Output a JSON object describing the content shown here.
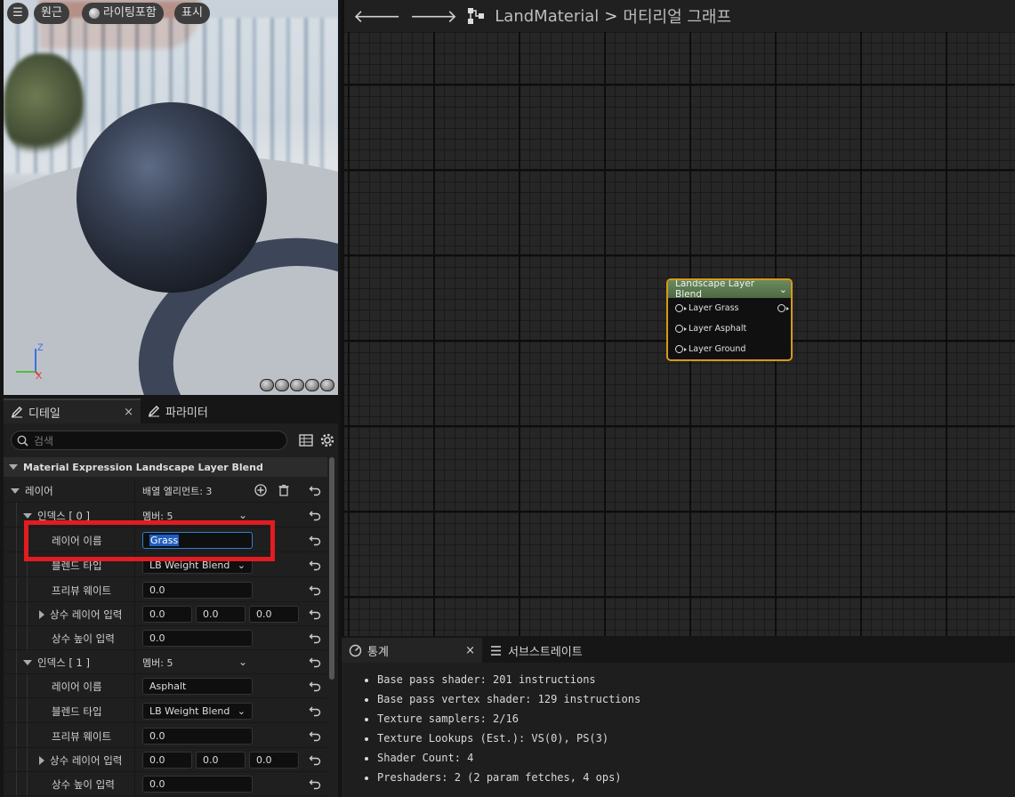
{
  "viewport": {
    "buttons": {
      "menu": "☰",
      "perspective": "원근",
      "lighting": "라이팅포함",
      "show": "표시"
    },
    "gizmo": {
      "z": "Z",
      "x": "X"
    }
  },
  "details": {
    "tabs": [
      {
        "label": "디테일"
      },
      {
        "label": "파라미터"
      }
    ],
    "search_placeholder": "검색",
    "category": "Material Expression Landscape Layer Blend",
    "layers_label": "레이어",
    "layers_value": "배열 엘리먼트: 3",
    "index0": {
      "label": "인덱스 [ 0 ]",
      "members": "멤버: 5"
    },
    "index1": {
      "label": "인덱스 [ 1 ]",
      "members": "멤버: 5"
    },
    "props": {
      "layer_name": "레이어 이름",
      "blend_type": "블렌드 타입",
      "preview_weight": "프리뷰 웨이트",
      "const_layer_input": "상수 레이어 입력",
      "const_height_input": "상수 높이 입력"
    },
    "layer0": {
      "name": "Grass",
      "blend": "LB Weight Blend",
      "preview": "0.0",
      "const": [
        "0.0",
        "0.0",
        "0.0"
      ],
      "height": "0.0"
    },
    "layer1": {
      "name": "Asphalt",
      "blend": "LB Weight Blend",
      "preview": "0.0",
      "const": [
        "0.0",
        "0.0",
        "0.0"
      ],
      "height": "0.0"
    }
  },
  "graph": {
    "breadcrumb": {
      "asset": "LandMaterial",
      "sep": ">",
      "view": "머티리얼 그래프"
    },
    "node": {
      "title": "Landscape Layer Blend",
      "inputs": [
        "Layer Grass",
        "Layer Asphalt",
        "Layer Ground"
      ]
    }
  },
  "stats": {
    "tabs": [
      {
        "label": "통계"
      },
      {
        "label": "서브스트레이트"
      }
    ],
    "lines": [
      "Base pass shader: 201 instructions",
      "Base pass vertex shader: 129 instructions",
      "Texture samplers: 2/16",
      "Texture Lookups (Est.): VS(0), PS(3)",
      "Shader Count: 4",
      "Preshaders: 2  (2 param fetches, 4 ops)"
    ]
  },
  "colors": {
    "node_border": "#d79a1c",
    "highlight": "#e21c21",
    "selection": "#1f5fbf"
  }
}
